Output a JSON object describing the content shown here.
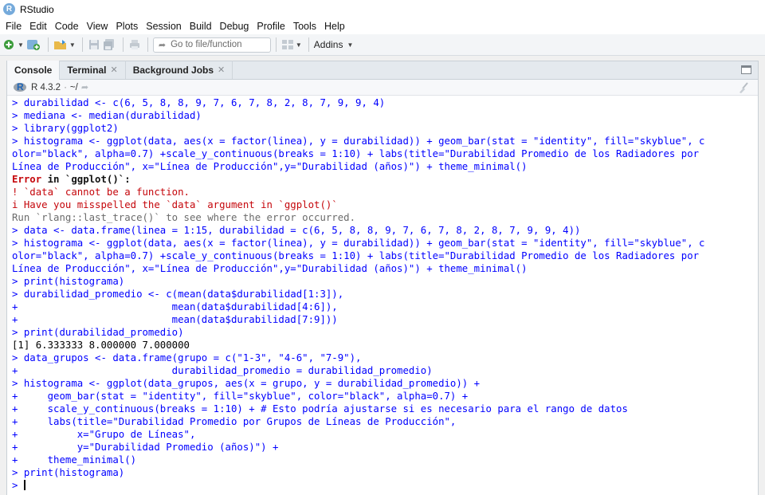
{
  "window": {
    "title": "RStudio"
  },
  "menu": [
    "File",
    "Edit",
    "Code",
    "View",
    "Plots",
    "Session",
    "Build",
    "Debug",
    "Profile",
    "Tools",
    "Help"
  ],
  "toolbar": {
    "goto_placeholder": "Go to file/function",
    "addins_label": "Addins"
  },
  "tabs": [
    {
      "label": "Console",
      "active": true,
      "closable": false
    },
    {
      "label": "Terminal",
      "active": false,
      "closable": true
    },
    {
      "label": "Background Jobs",
      "active": false,
      "closable": true
    }
  ],
  "console_header": {
    "version": "R 4.3.2",
    "path": "~/"
  },
  "console_lines": [
    {
      "type": "cmd",
      "text": "> durabilidad <- c(6, 5, 8, 8, 9, 7, 6, 7, 8, 2, 8, 7, 9, 9, 4)"
    },
    {
      "type": "cmd",
      "text": "> mediana <- median(durabilidad)"
    },
    {
      "type": "cmd",
      "text": "> library(ggplot2)"
    },
    {
      "type": "cmd",
      "text": "> histograma <- ggplot(data, aes(x = factor(linea), y = durabilidad)) + geom_bar(stat = \"identity\", fill=\"skyblue\", c"
    },
    {
      "type": "cmd",
      "text": "olor=\"black\", alpha=0.7) +scale_y_continuous(breaks = 1:10) + labs(title=\"Durabilidad Promedio de los Radiadores por"
    },
    {
      "type": "cmd",
      "text": "Línea de Producción\", x=\"Línea de Producción\",y=\"Durabilidad (años)\") + theme_minimal()"
    },
    {
      "type": "error-head",
      "label": "Error",
      "rest": " in `ggplot()`:"
    },
    {
      "type": "err",
      "text": "! `data` cannot be a function."
    },
    {
      "type": "err",
      "text": "i Have you misspelled the `data` argument in `ggplot()`"
    },
    {
      "type": "note",
      "text": "Run `rlang::last_trace()` to see where the error occurred."
    },
    {
      "type": "cmd",
      "text": "> data <- data.frame(linea = 1:15, durabilidad = c(6, 5, 8, 8, 9, 7, 6, 7, 8, 2, 8, 7, 9, 9, 4))"
    },
    {
      "type": "cmd",
      "text": "> histograma <- ggplot(data, aes(x = factor(linea), y = durabilidad)) + geom_bar(stat = \"identity\", fill=\"skyblue\", c"
    },
    {
      "type": "cmd",
      "text": "olor=\"black\", alpha=0.7) +scale_y_continuous(breaks = 1:10) + labs(title=\"Durabilidad Promedio de los Radiadores por"
    },
    {
      "type": "cmd",
      "text": "Línea de Producción\", x=\"Línea de Producción\",y=\"Durabilidad (años)\") + theme_minimal()"
    },
    {
      "type": "cmd",
      "text": "> print(histograma)"
    },
    {
      "type": "cmd",
      "text": "> durabilidad_promedio <- c(mean(data$durabilidad[1:3]),"
    },
    {
      "type": "cmd",
      "text": "+                          mean(data$durabilidad[4:6]),"
    },
    {
      "type": "cmd",
      "text": "+                          mean(data$durabilidad[7:9]))"
    },
    {
      "type": "cmd",
      "text": "> print(durabilidad_promedio)"
    },
    {
      "type": "out",
      "text": "[1] 6.333333 8.000000 7.000000"
    },
    {
      "type": "cmd",
      "text": "> data_grupos <- data.frame(grupo = c(\"1-3\", \"4-6\", \"7-9\"),"
    },
    {
      "type": "cmd",
      "text": "+                          durabilidad_promedio = durabilidad_promedio)"
    },
    {
      "type": "cmd",
      "text": "> histograma <- ggplot(data_grupos, aes(x = grupo, y = durabilidad_promedio)) +"
    },
    {
      "type": "cmd",
      "text": "+     geom_bar(stat = \"identity\", fill=\"skyblue\", color=\"black\", alpha=0.7) +"
    },
    {
      "type": "cmd",
      "text": "+     scale_y_continuous(breaks = 1:10) + # Esto podría ajustarse si es necesario para el rango de datos"
    },
    {
      "type": "cmd",
      "text": "+     labs(title=\"Durabilidad Promedio por Grupos de Líneas de Producción\","
    },
    {
      "type": "cmd",
      "text": "+          x=\"Grupo de Líneas\","
    },
    {
      "type": "cmd",
      "text": "+          y=\"Durabilidad Promedio (años)\") +"
    },
    {
      "type": "cmd",
      "text": "+     theme_minimal()"
    },
    {
      "type": "cmd",
      "text": "> print(histograma)"
    },
    {
      "type": "prompt",
      "text": "> "
    }
  ],
  "colors": {
    "command": "#0000ff",
    "error": "#c5060b",
    "note": "#6b6b6b"
  }
}
